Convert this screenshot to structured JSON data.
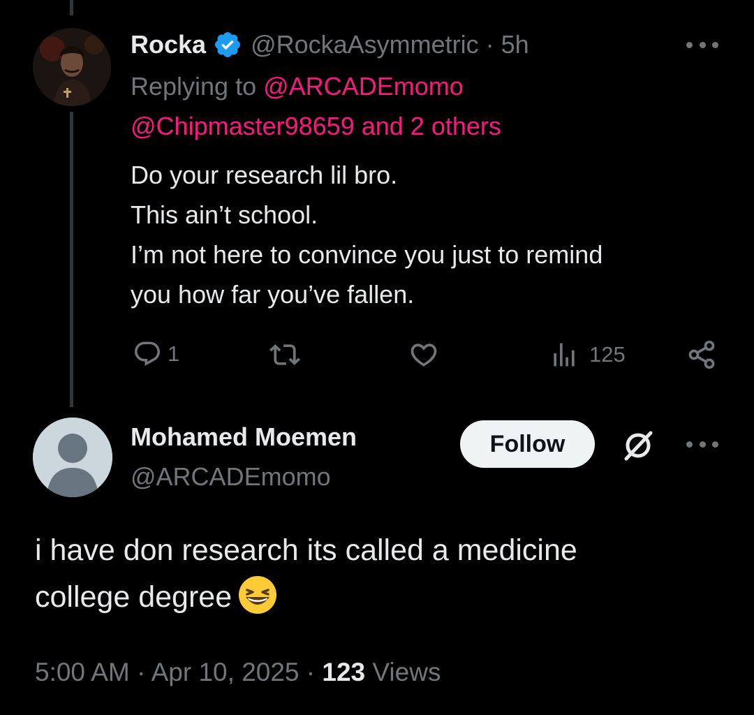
{
  "reply_tweet": {
    "author_name": "Rocka",
    "handle": "@RockaAsymmetric",
    "separator": "·",
    "time": "5h",
    "replying_prefix": "Replying to",
    "replying_mention_1": "@ARCADEmomo",
    "replying_mention_2": "@Chipmaster98659",
    "replying_others": "and 2 others",
    "body": "Do your research lil bro.\nThis ain’t school.\nI’m not here to convince you just to remind\nyou how far you’ve fallen.",
    "reply_count": "1",
    "views_count": "125"
  },
  "main_tweet": {
    "author_name": "Mohamed Moemen",
    "handle": "@ARCADEmomo",
    "follow_label": "Follow",
    "body": "i have don research its called a medicine\ncollege degree",
    "emoji_name": "grinning-squinting-face",
    "time": "5:00 AM",
    "date": "Apr 10, 2025",
    "views_count": "123",
    "views_label": "Views",
    "separator": "·"
  },
  "colors": {
    "background": "#000000",
    "text_primary": "#e7e9ea",
    "text_secondary": "#71767b",
    "mention": "#f91880",
    "verified": "#1d9bf0"
  }
}
